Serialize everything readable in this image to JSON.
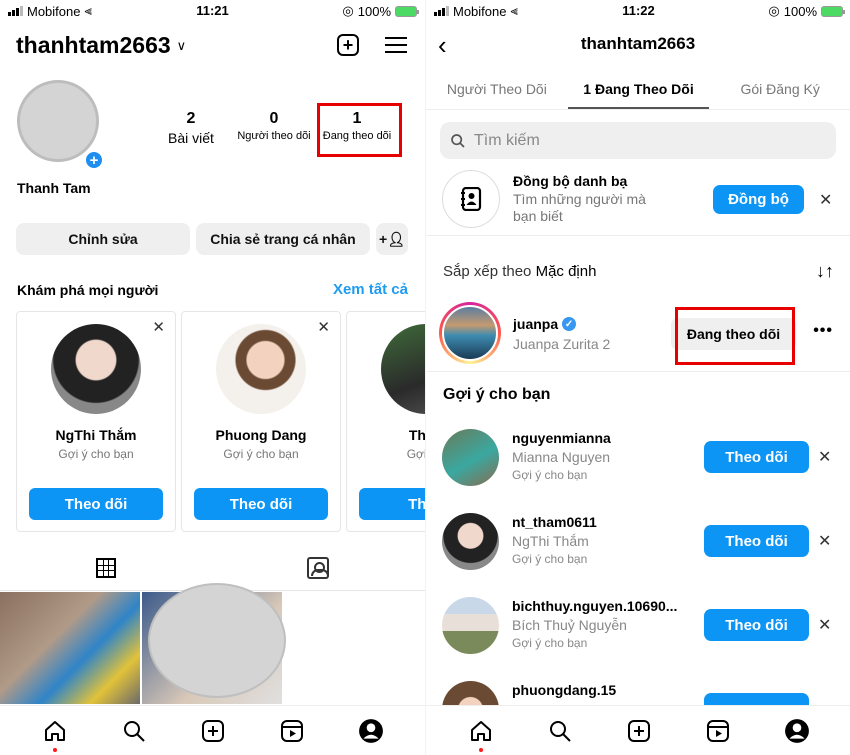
{
  "left": {
    "status_bar": {
      "carrier": "Mobifone",
      "time": "11:21",
      "battery": "100%"
    },
    "header": {
      "username": "thanhtam2663"
    },
    "profile": {
      "display_name": "Thanh Tam",
      "stats": [
        {
          "count": "2",
          "label": "Bài viết"
        },
        {
          "count": "0",
          "label": "Người theo dõi"
        },
        {
          "count": "1",
          "label": "Đang theo dõi"
        }
      ]
    },
    "buttons": {
      "edit": "Chỉnh sửa",
      "share": "Chia sẻ trang cá nhân"
    },
    "discover": {
      "title": "Khám phá mọi người",
      "see_all": "Xem tất cả",
      "cards": [
        {
          "name": "NgThi Thắm",
          "sub": "Gợi ý cho bạn",
          "button": "Theo dõi"
        },
        {
          "name": "Phuong Dang",
          "sub": "Gợi ý cho bạn",
          "button": "Theo dõi"
        },
        {
          "name": "Thi P",
          "sub": "Gợi ý c",
          "button": "Theo"
        }
      ]
    }
  },
  "right": {
    "status_bar": {
      "carrier": "Mobifone",
      "time": "11:22",
      "battery": "100%"
    },
    "header": {
      "title": "thanhtam2663"
    },
    "tabs": [
      {
        "label": "Người Theo Dõi",
        "active": false
      },
      {
        "label": "1 Đang Theo Dõi",
        "active": true
      },
      {
        "label": "Gói Đăng Ký",
        "active": false
      }
    ],
    "search": {
      "placeholder": "Tìm kiếm"
    },
    "sync": {
      "title": "Đồng bộ danh bạ",
      "desc": "Tìm những người mà bạn biết",
      "button": "Đồng bộ"
    },
    "sort": {
      "prefix": "Sắp xếp theo ",
      "value": "Mặc định"
    },
    "following": [
      {
        "username": "juanpa",
        "verified": true,
        "name": "Juanpa Zurita 2",
        "button": "Đang theo dõi"
      }
    ],
    "suggestions_title": "Gợi ý cho bạn",
    "suggestions": [
      {
        "username": "nguyenmianna",
        "name": "Mianna Nguyen",
        "sub": "Gợi ý cho bạn",
        "button": "Theo dõi"
      },
      {
        "username": "nt_tham0611",
        "name": "NgThi Thắm",
        "sub": "Gợi ý cho bạn",
        "button": "Theo dõi"
      },
      {
        "username": "bichthuy.nguyen.10690...",
        "name": "Bích Thuỷ Nguyễn",
        "sub": "Gợi ý cho bạn",
        "button": "Theo dõi"
      },
      {
        "username": "phuongdang.15",
        "name": "",
        "sub": "",
        "button": ""
      }
    ]
  },
  "colors": {
    "accent": "#0d95f5",
    "highlight_box": "#e60000",
    "notification_dot": "#ff1a1a"
  }
}
